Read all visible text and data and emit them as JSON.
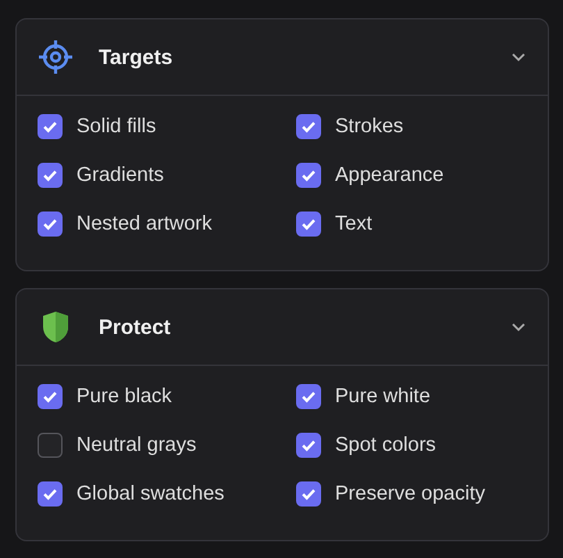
{
  "sections": [
    {
      "title": "Targets",
      "expanded": true,
      "options": [
        {
          "label": "Solid fills",
          "checked": true
        },
        {
          "label": "Strokes",
          "checked": true
        },
        {
          "label": "Gradients",
          "checked": true
        },
        {
          "label": "Appearance",
          "checked": true
        },
        {
          "label": "Nested artwork",
          "checked": true
        },
        {
          "label": "Text",
          "checked": true
        }
      ]
    },
    {
      "title": "Protect",
      "expanded": true,
      "options": [
        {
          "label": "Pure black",
          "checked": true
        },
        {
          "label": "Pure white",
          "checked": true
        },
        {
          "label": "Neutral grays",
          "checked": false
        },
        {
          "label": "Spot colors",
          "checked": true
        },
        {
          "label": "Global swatches",
          "checked": true
        },
        {
          "label": "Preserve opacity",
          "checked": true
        }
      ]
    }
  ]
}
